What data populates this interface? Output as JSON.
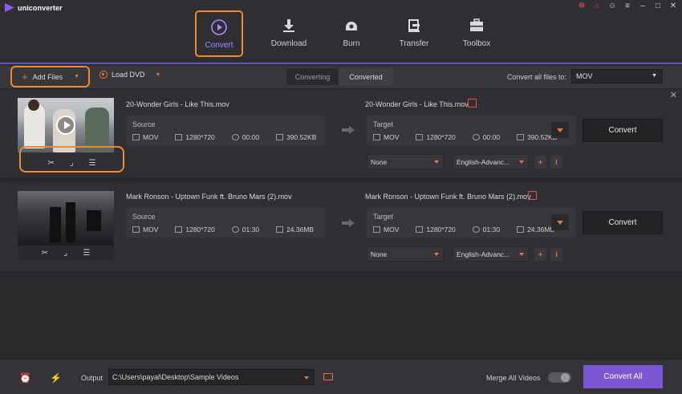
{
  "app": {
    "name": "uniconverter"
  },
  "window_controls": [
    "gift-icon",
    "cart-icon",
    "user-icon",
    "menu-icon",
    "minimize-icon",
    "maximize-icon",
    "close-icon"
  ],
  "nav": {
    "items": [
      {
        "label": "Convert",
        "icon": "convert-icon",
        "active": true
      },
      {
        "label": "Download",
        "icon": "download-icon",
        "active": false
      },
      {
        "label": "Burn",
        "icon": "burn-icon",
        "active": false
      },
      {
        "label": "Transfer",
        "icon": "transfer-icon",
        "active": false
      },
      {
        "label": "Toolbox",
        "icon": "toolbox-icon",
        "active": false
      }
    ]
  },
  "toolbar": {
    "add_files": "Add Files",
    "load_dvd": "Load DVD",
    "tab_converting": "Converting",
    "tab_converted": "Converted",
    "convert_all_label": "Convert all files to:",
    "format": "MOV"
  },
  "files": [
    {
      "name": "20-Wonder Girls - Like This.mov",
      "source": {
        "label": "Source",
        "format": "MOV",
        "resolution": "1280*720",
        "duration": "00:00",
        "size": "390.52KB"
      },
      "target_name": "20-Wonder Girls - Like This.mov",
      "target": {
        "label": "Target",
        "format": "MOV",
        "resolution": "1280*720",
        "duration": "00:00",
        "size": "390.52KB"
      },
      "subtitle": "None",
      "audio": "English-Advanc...",
      "convert": "Convert"
    },
    {
      "name": "Mark Ronson - Uptown Funk ft. Bruno Mars (2).mov",
      "source": {
        "label": "Source",
        "format": "MOV",
        "resolution": "1280*720",
        "duration": "01:30",
        "size": "24.36MB"
      },
      "target_name": "Mark Ronson - Uptown Funk ft. Bruno Mars (2).mov",
      "target": {
        "label": "Target",
        "format": "MOV",
        "resolution": "1280*720",
        "duration": "01:30",
        "size": "24.36MB"
      },
      "subtitle": "None",
      "audio": "English-Advanc...",
      "convert": "Convert"
    }
  ],
  "bottom": {
    "output_label": "Output",
    "output_path": "C:\\Users\\payal\\Desktop\\Sample Videos",
    "merge_label": "Merge All Videos",
    "merge_on": false,
    "convert_all": "Convert All"
  },
  "colors": {
    "accent": "#7b57d6",
    "highlight": "#f08a2c",
    "icon_orange": "#e8763a"
  }
}
